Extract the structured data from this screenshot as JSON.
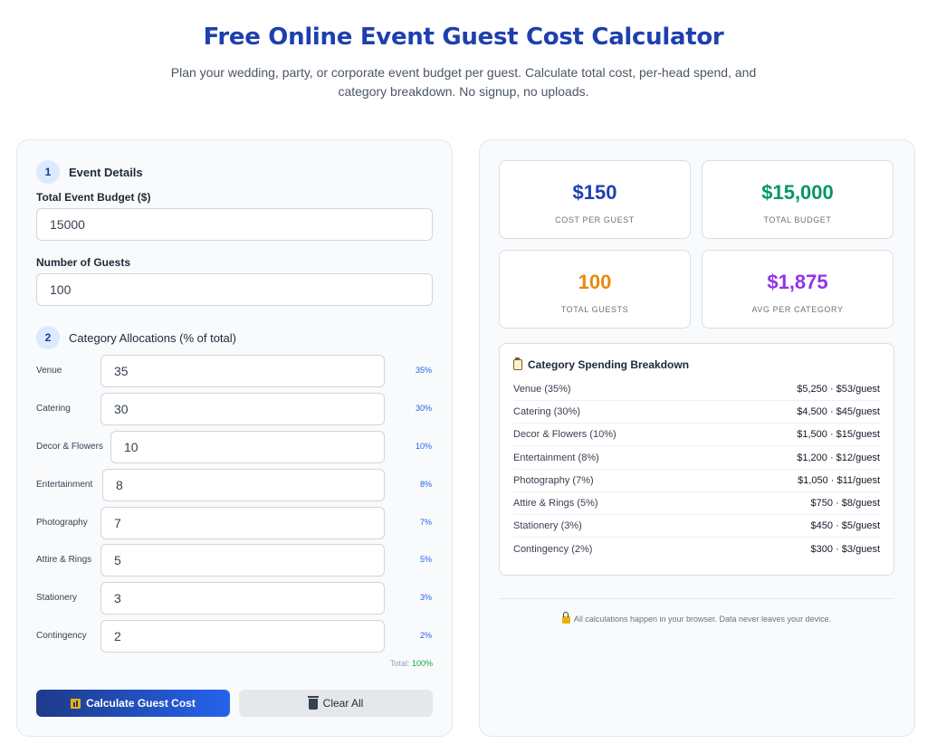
{
  "header": {
    "title": "Free Online Event Guest Cost Calculator",
    "subtitle": "Plan your wedding, party, or corporate event budget per guest. Calculate total cost, per-head spend, and category breakdown. No signup, no uploads."
  },
  "form": {
    "step1": {
      "number": "1",
      "label": "Event Details"
    },
    "budget": {
      "label": "Total Event Budget ($)",
      "value": "15000"
    },
    "guests": {
      "label": "Number of Guests",
      "value": "100"
    },
    "step2": {
      "number": "2",
      "label": "Category Allocations (% of total)"
    },
    "categories": [
      {
        "label": "Venue",
        "value": "35",
        "pct": "35%"
      },
      {
        "label": "Catering",
        "value": "30",
        "pct": "30%"
      },
      {
        "label": "Decor & Flowers",
        "value": "10",
        "pct": "10%"
      },
      {
        "label": "Entertainment",
        "value": "8",
        "pct": "8%"
      },
      {
        "label": "Photography",
        "value": "7",
        "pct": "7%"
      },
      {
        "label": "Attire & Rings",
        "value": "5",
        "pct": "5%"
      },
      {
        "label": "Stationery",
        "value": "3",
        "pct": "3%"
      },
      {
        "label": "Contingency",
        "value": "2",
        "pct": "2%"
      }
    ],
    "total": {
      "prefix": "Total:",
      "value": "100%"
    },
    "calculate_label": "Calculate Guest Cost",
    "clear_label": "Clear All"
  },
  "results": {
    "cards": [
      {
        "value": "$150",
        "label": "COST PER GUEST",
        "color": "#1e40af"
      },
      {
        "value": "$15,000",
        "label": "TOTAL BUDGET",
        "color": "#059669"
      },
      {
        "value": "100",
        "label": "TOTAL GUESTS",
        "color": "#ea8a0c"
      },
      {
        "value": "$1,875",
        "label": "AVG PER CATEGORY",
        "color": "#9333ea"
      }
    ],
    "breakdown": {
      "title": "Category Spending Breakdown",
      "rows": [
        {
          "name": "Venue (35%)",
          "amount": "$5,250 · $53/guest"
        },
        {
          "name": "Catering (30%)",
          "amount": "$4,500 · $45/guest"
        },
        {
          "name": "Decor & Flowers (10%)",
          "amount": "$1,500 · $15/guest"
        },
        {
          "name": "Entertainment (8%)",
          "amount": "$1,200 · $12/guest"
        },
        {
          "name": "Photography (7%)",
          "amount": "$1,050 · $11/guest"
        },
        {
          "name": "Attire & Rings (5%)",
          "amount": "$750 · $8/guest"
        },
        {
          "name": "Stationery (3%)",
          "amount": "$450 · $5/guest"
        },
        {
          "name": "Contingency (2%)",
          "amount": "$300 · $3/guest"
        }
      ]
    },
    "privacy": "All calculations happen in your browser. Data never leaves your device."
  }
}
